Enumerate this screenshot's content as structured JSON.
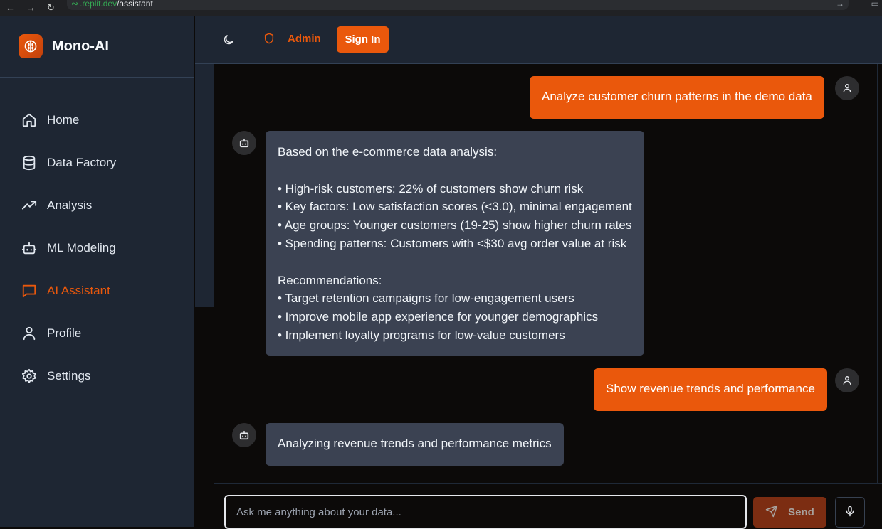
{
  "browser": {
    "url_host": ".replit.dev",
    "url_path": "/assistant"
  },
  "brand": {
    "name": "Mono-AI"
  },
  "sidebar": {
    "items": [
      {
        "label": "Home",
        "icon": "home-icon"
      },
      {
        "label": "Data Factory",
        "icon": "database-icon"
      },
      {
        "label": "Analysis",
        "icon": "trending-up-icon"
      },
      {
        "label": "ML Modeling",
        "icon": "bot-icon"
      },
      {
        "label": "AI Assistant",
        "icon": "message-square-icon",
        "active": true
      },
      {
        "label": "Profile",
        "icon": "user-icon"
      },
      {
        "label": "Settings",
        "icon": "gear-icon"
      }
    ]
  },
  "header": {
    "admin_label": "Admin",
    "signin_label": "Sign In"
  },
  "messages": [
    {
      "role": "user",
      "text": "Analyze customer churn patterns in the demo data"
    },
    {
      "role": "assistant",
      "lines": [
        "Based on the e-commerce data analysis:",
        "",
        "• High-risk customers: 22% of customers show churn risk",
        "• Key factors: Low satisfaction scores (<3.0), minimal engagement",
        "• Age groups: Younger customers (19-25) show higher churn rates",
        "• Spending patterns: Customers with <$30 avg order value at risk",
        "",
        "Recommendations:",
        "• Target retention campaigns for low-engagement users",
        "• Improve mobile app experience for younger demographics",
        "• Implement loyalty programs for low-value customers"
      ]
    },
    {
      "role": "user",
      "text": "Show revenue trends and performance"
    },
    {
      "role": "assistant",
      "lines": [
        "Analyzing revenue trends and performance metrics"
      ]
    }
  ],
  "composer": {
    "placeholder": "Ask me anything about your data...",
    "send_label": "Send"
  },
  "colors": {
    "accent": "#ea580c",
    "sidebar_bg": "#1e2633",
    "chat_bg": "#0c0a09",
    "bot_bubble": "#3b4252"
  }
}
